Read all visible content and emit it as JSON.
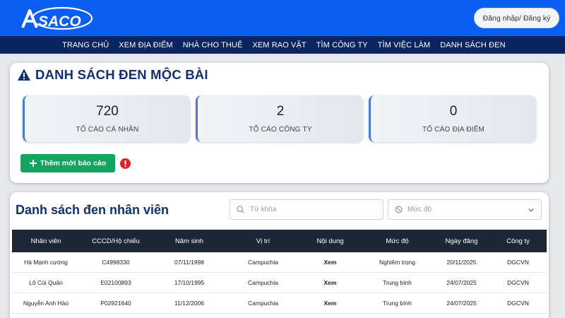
{
  "header": {
    "logo_text": "ASACO",
    "login_label": "Đăng nhập/ Đăng ký"
  },
  "nav": {
    "items": [
      "TRANG CHỦ",
      "XEM ĐỊA ĐIỂM",
      "NHÀ CHO THUÊ",
      "XEM RAO VẶT",
      "TÌM CÔNG TY",
      "TÌM VIỆC LÀM",
      "DANH SÁCH ĐEN"
    ]
  },
  "summary": {
    "title": "DANH SÁCH ĐEN MỘC BÀI",
    "stats": [
      {
        "value": "720",
        "label": "TỐ CÁO CÁ NHÂN"
      },
      {
        "value": "2",
        "label": "TỐ CÁO CÔNG TY"
      },
      {
        "value": "0",
        "label": "TỐ CÁO ĐỊA ĐIỂM"
      }
    ],
    "add_button_label": "Thêm mới báo cáo"
  },
  "list": {
    "title": "Danh sách đen nhân viên",
    "search_placeholder": "Từ khóa",
    "level_select_value": "Mức độ",
    "columns": [
      "Nhân viên",
      "CCCD/Hộ chiếu",
      "Năm sinh",
      "Vị trí",
      "Nội dung",
      "Mức độ",
      "Ngày đăng",
      "Công ty"
    ],
    "rows": [
      {
        "name": "Hà Mạnh cường",
        "id": "C4998330",
        "dob": "07/11/1998",
        "location": "Campuchia",
        "content": "Xem",
        "level": "Nghiêm trọng",
        "date": "20/11/2025",
        "company": "DGCVN"
      },
      {
        "name": "Lô Cúi Quấn",
        "id": "E02100893",
        "dob": "17/10/1995",
        "location": "Campuchia",
        "content": "Xem",
        "level": "Trung bình",
        "date": "24/07/2025",
        "company": "DGCVN"
      },
      {
        "name": "Nguyễn Anh Hào",
        "id": "P02921640",
        "dob": "11/12/2006",
        "location": "Campuchia",
        "content": "Xem",
        "level": "Trung bình",
        "date": "24/07/2025",
        "company": "DGCVN"
      }
    ]
  },
  "colors": {
    "header_blue": "#0a5ff2",
    "nav_navy": "#0b2560",
    "title_navy": "#12306e",
    "add_green": "#16a35f",
    "alert_red": "#e02424",
    "table_head": "#1e2738"
  }
}
